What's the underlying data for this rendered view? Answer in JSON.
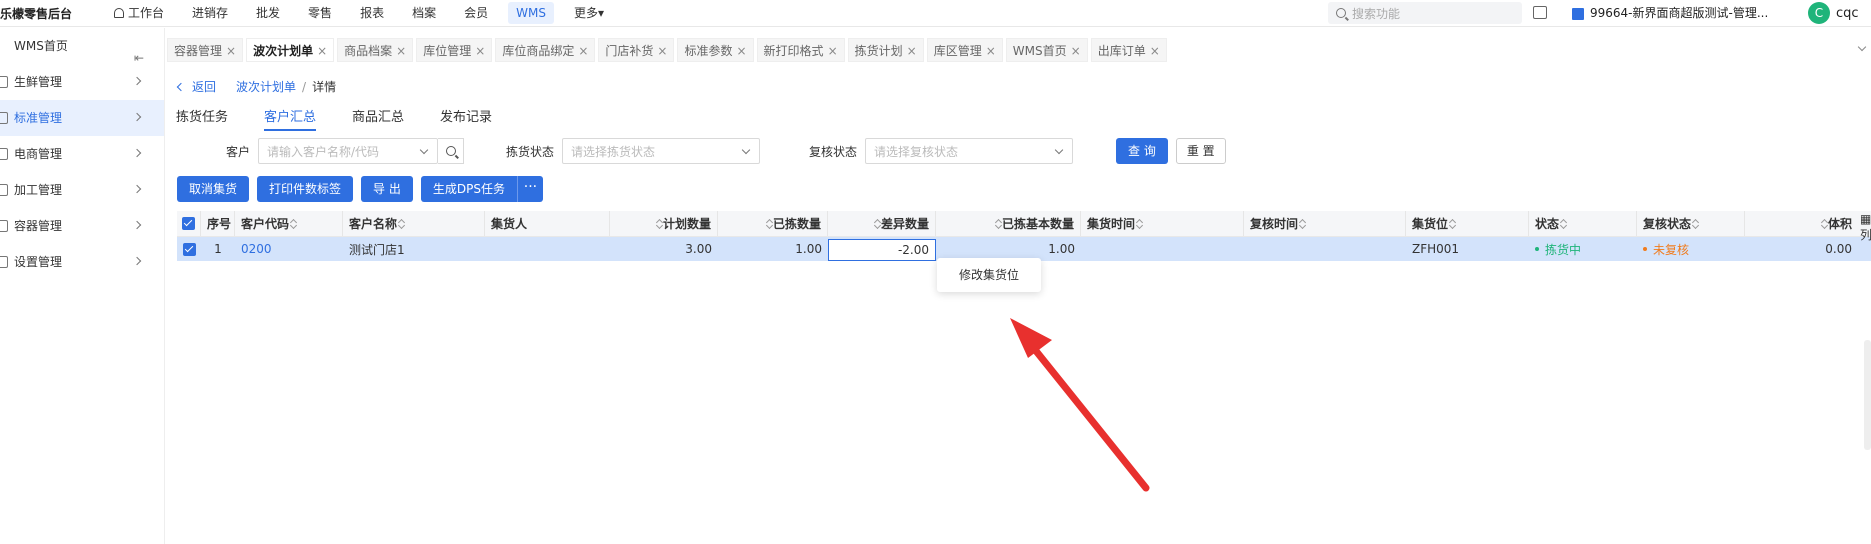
{
  "brand": "乐檬零售后台",
  "nav": [
    "工作台",
    "进销存",
    "批发",
    "零售",
    "报表",
    "档案",
    "会员",
    "WMS",
    "更多▾"
  ],
  "search": {
    "placeholder": "搜索功能"
  },
  "store": "99664-新界面商超版测试-管理...",
  "user": {
    "initial": "C",
    "name": "cqc"
  },
  "sidebar": [
    {
      "label": "WMS首页"
    },
    {
      "label": "生鲜管理"
    },
    {
      "label": "标准管理"
    },
    {
      "label": "电商管理"
    },
    {
      "label": "加工管理"
    },
    {
      "label": "容器管理"
    },
    {
      "label": "设置管理"
    }
  ],
  "tabs": [
    "容器管理",
    "波次计划单",
    "商品档案",
    "库位管理",
    "库位商品绑定",
    "门店补货",
    "标准参数",
    "新打印格式",
    "拣货计划",
    "库区管理",
    "WMS首页",
    "出库订单"
  ],
  "breadcrumb": {
    "back": "返回",
    "parent": "波次计划单",
    "sep": "/",
    "current": "详情"
  },
  "subtabs": [
    "拣货任务",
    "客户汇总",
    "商品汇总",
    "发布记录"
  ],
  "filters": {
    "customer": {
      "label": "客户",
      "placeholder": "请输入客户名称/代码"
    },
    "pick_status": {
      "label": "拣货状态",
      "placeholder": "请选择拣货状态"
    },
    "review_status": {
      "label": "复核状态",
      "placeholder": "请选择复核状态"
    },
    "query": "查 询",
    "reset": "重 置"
  },
  "actions": [
    "取消集货",
    "打印件数标签",
    "导 出",
    "生成DPS任务"
  ],
  "actions_more": "···",
  "table": {
    "headers": [
      "序号",
      "客户代码",
      "客户名称",
      "集货人",
      "计划数量",
      "已拣数量",
      "差异数量",
      "已拣基本数量",
      "集货时间",
      "复核时间",
      "集货位",
      "状态",
      "复核状态",
      "体积"
    ],
    "rows": [
      {
        "seq": "1",
        "customer_code": "0200",
        "customer_name": "测试门店1",
        "collector": "",
        "plan_qty": "3.00",
        "picked_qty": "1.00",
        "diff_qty": "-2.00",
        "picked_base_qty": "1.00",
        "collect_time": "",
        "review_time": "",
        "slot": "ZFH001",
        "status": "拣货中",
        "review_status": "未复核",
        "volume": "0.00"
      }
    ]
  },
  "tooltip": "修改集货位",
  "right_edge": "列",
  "colors": {
    "accent": "#2f6fe0",
    "row_selected": "#d3e3fb",
    "status_green": "#1fb47a",
    "status_orange": "#f07c1e",
    "arrow": "#e8302e"
  }
}
